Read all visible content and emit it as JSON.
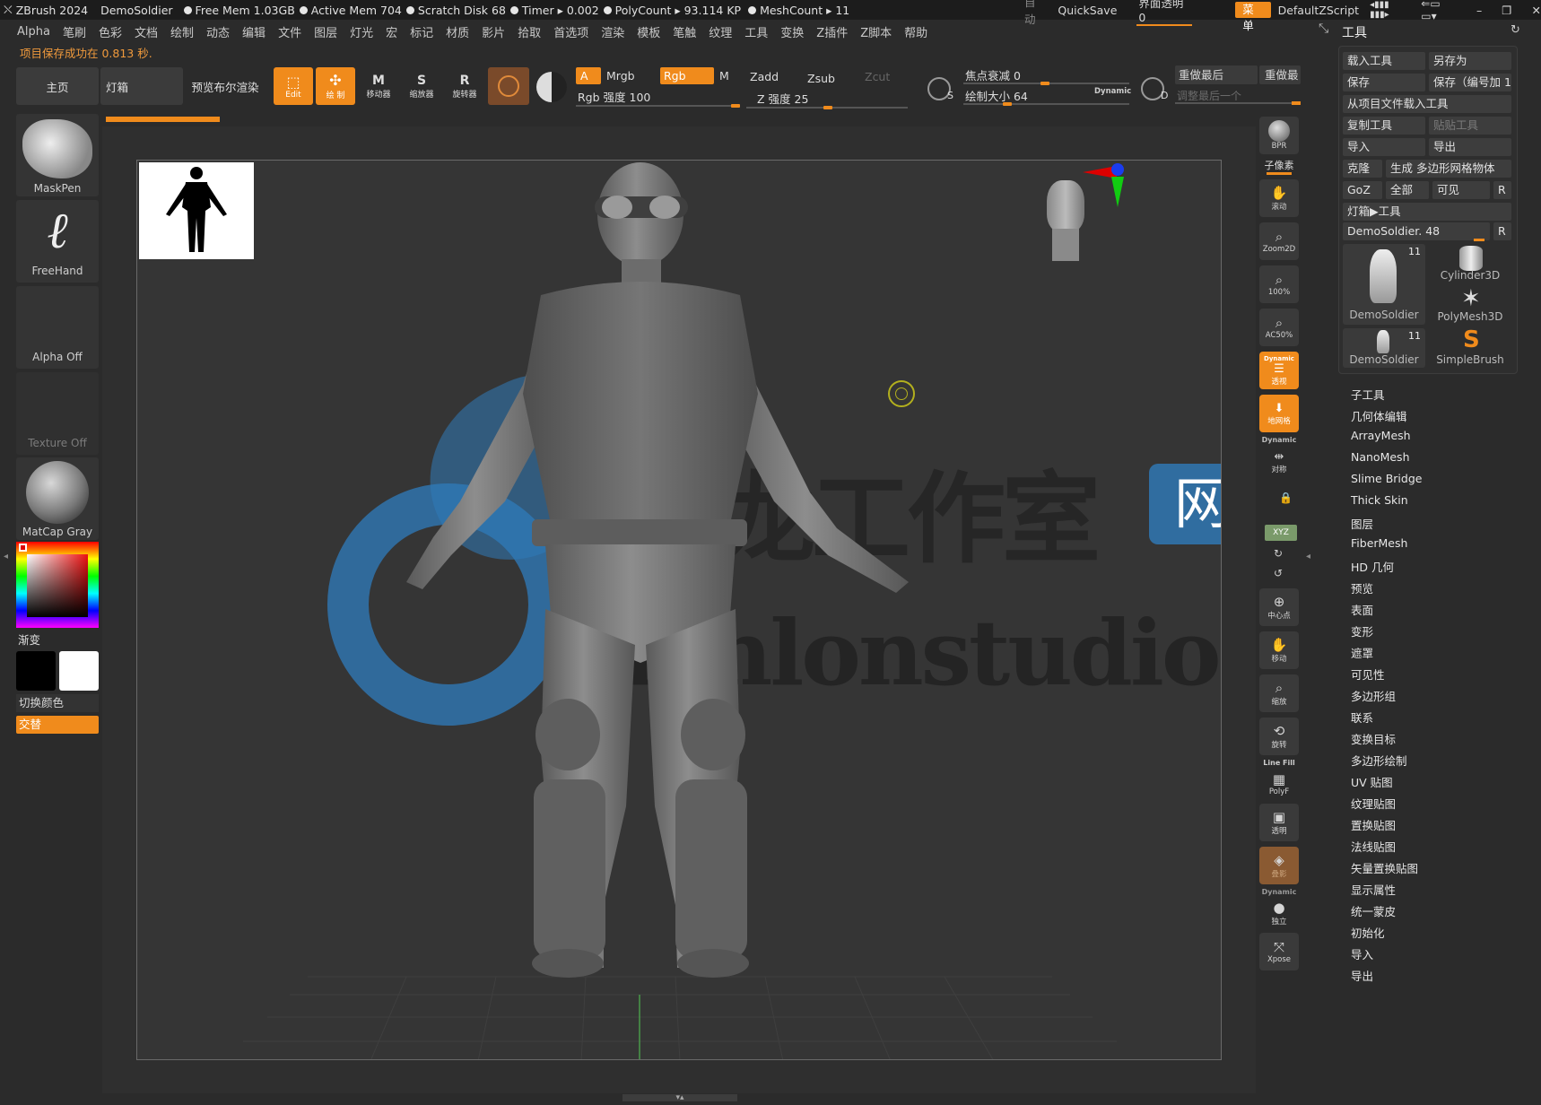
{
  "titlebar": {
    "app": "ZBrush 2024",
    "doc": "DemoSoldier",
    "free_mem": "Free Mem 1.03GB",
    "active_mem": "Active Mem 704",
    "scratch": "Scratch Disk 68",
    "timer": "Timer ▸ 0.002",
    "polycount": "PolyCount ▸ 93.114 KP",
    "meshcount": "MeshCount ▸ 11",
    "auto": "自动",
    "quicksave": "QuickSave",
    "ui_transparency": "界面透明 0",
    "menu_btn": "菜单",
    "zscript": "DefaultZScript"
  },
  "menubar": [
    "Alpha",
    "笔刷",
    "色彩",
    "文档",
    "绘制",
    "动态",
    "编辑",
    "文件",
    "图层",
    "灯光",
    "宏",
    "标记",
    "材质",
    "影片",
    "拾取",
    "首选项",
    "渲染",
    "模板",
    "笔触",
    "纹理",
    "工具",
    "变换",
    "Z插件",
    "Z脚本",
    "帮助"
  ],
  "status_message": "项目保存成功在 0.813 秒.",
  "toolbar": {
    "home": "主页",
    "lightbox": "灯箱",
    "bpr": "预览布尔渲染",
    "edit": "Edit",
    "draw": "绘 制",
    "move": "移动器",
    "scale": "缩放器",
    "rotate": "旋转器",
    "a": "A",
    "mrgb": "Mrgb",
    "rgb": "Rgb",
    "m": "M",
    "zadd": "Zadd",
    "zsub": "Zsub",
    "zcut": "Zcut",
    "rgb_intensity": "Rgb 强度 100",
    "z_intensity": "Z 强度 25",
    "focal_shift": "焦点衰减 0",
    "draw_size": "绘制大小 64",
    "dynamic": "Dynamic",
    "redo_last": "重做最后",
    "redo_last2": "重做最",
    "adjust_last": "调整最后一个"
  },
  "left": {
    "brush": "MaskPen",
    "stroke": "FreeHand",
    "alpha": "Alpha Off",
    "texture": "Texture Off",
    "material": "MatCap Gray",
    "gradient": "渐变",
    "switch_color": "切换颜色",
    "alternate": "交替"
  },
  "shelf": {
    "bpr": "BPR",
    "subpixel": "子像素",
    "scroll": "滚动",
    "zoom2d": "Zoom2D",
    "zoom100": "100%",
    "ac50": "AC50%",
    "persp_dynamic": "Dynamic",
    "persp": "透视",
    "floor": "地网格",
    "sym_dynamic": "Dynamic",
    "sym": "对称",
    "xyz": "XYZ",
    "center": "中心点",
    "move": "移动",
    "zoom": "缩放",
    "rotate": "旋转",
    "linefill": "Line Fill",
    "polyf": "PolyF",
    "transp": "透明",
    "ghost": "叠影",
    "solo_dynamic": "Dynamic",
    "solo": "独立",
    "xpose": "Xpose"
  },
  "panel": {
    "title": "工具",
    "load_tool": "载入工具",
    "save_as": "另存为",
    "save": "保存",
    "save_inc": "保存（编号加 1）",
    "load_from_project": "从项目文件载入工具",
    "copy_tool": "复制工具",
    "paste_tool": "贴贴工具",
    "import": "导入",
    "export": "导出",
    "clone": "克隆",
    "make_polymesh": "生成 多边形网格物体",
    "goz": "GoZ",
    "all": "全部",
    "visible": "可见",
    "r": "R",
    "lightbox_tool": "灯箱▶工具",
    "current_tool": "DemoSoldier. 48",
    "thumbs": [
      {
        "label": "DemoSoldier",
        "count": "11"
      },
      {
        "label": "Cylinder3D",
        "count": ""
      },
      {
        "label": "PolyMesh3D",
        "count": ""
      },
      {
        "label": "DemoSoldier",
        "count": "11"
      },
      {
        "label": "SimpleBrush",
        "count": ""
      }
    ],
    "subpalettes": [
      "子工具",
      "几何体编辑",
      "ArrayMesh",
      "NanoMesh",
      "Slime Bridge",
      "Thick Skin",
      "图层",
      "FiberMesh",
      "HD 几何",
      "预览",
      "表面",
      "变形",
      "遮罩",
      "可见性",
      "多边形组",
      "联系",
      "变换目标",
      "多边形绘制",
      "UV 贴图",
      "纹理贴图",
      "置换贴图",
      "法线贴图",
      "矢量置换贴图",
      "显示属性",
      "统一蒙皮",
      "初始化",
      "导入",
      "导出"
    ]
  },
  "watermark": {
    "cn": "路龙工作室",
    "badge": "网站",
    "en": "lenlonstudio.com"
  },
  "colors": {
    "accent": "#f08b1c",
    "bg": "#2b2b2b",
    "watermark_blue": "#2f7ab8"
  }
}
